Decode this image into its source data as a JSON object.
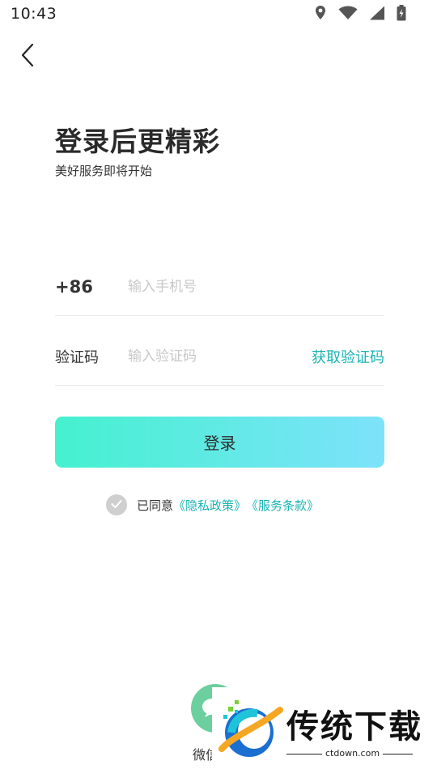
{
  "status_bar": {
    "time": "10:43",
    "icons": [
      "location-icon",
      "wifi-icon",
      "signal-icon",
      "battery-charging-icon"
    ]
  },
  "header": {
    "back_icon": "chevron-left-icon"
  },
  "intro": {
    "title": "登录后更精彩",
    "subtitle": "美好服务即将开始"
  },
  "form": {
    "country_code": "+86",
    "phone_placeholder": "输入手机号",
    "code_label": "验证码",
    "code_placeholder": "输入验证码",
    "get_code_label": "获取验证码"
  },
  "login_button": {
    "label": "登录",
    "gradient": [
      "#45f1cf",
      "#7de2fb"
    ]
  },
  "agreement": {
    "prefix": "已同意",
    "privacy_link": "《隐私政策》",
    "terms_link": "《服务条款》",
    "accent": "#1bb3b3"
  },
  "social": {
    "wechat_label": "微信",
    "wechat_color": "#6ccf9e"
  },
  "watermark": {
    "brand": "传统下载",
    "url": "ctdown.com"
  }
}
